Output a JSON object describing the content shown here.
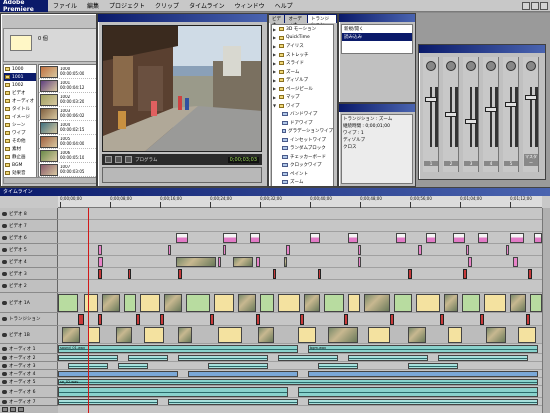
{
  "app": {
    "title": "Adobe Premiere"
  },
  "menu": [
    "ファイル",
    "編集",
    "プロジェクト",
    "クリップ",
    "タイムライン",
    "ウィンドウ",
    "ヘルプ"
  ],
  "project": {
    "label": "0 個",
    "bins": [
      {
        "label": "1000",
        "selected": false
      },
      {
        "label": "1001",
        "selected": true
      },
      {
        "label": "1002",
        "selected": false
      },
      {
        "label": "ビデオ",
        "selected": false
      },
      {
        "label": "オーディオ",
        "selected": false
      },
      {
        "label": "タイトル",
        "selected": false
      },
      {
        "label": "イメージ",
        "selected": false
      },
      {
        "label": "シーン",
        "selected": false
      },
      {
        "label": "ワイプ",
        "selected": false
      },
      {
        "label": "その他",
        "selected": false
      },
      {
        "label": "素材",
        "selected": false
      },
      {
        "label": "静止画",
        "selected": false
      },
      {
        "label": "BGM",
        "selected": false
      },
      {
        "label": "効果音",
        "selected": false
      },
      {
        "label": "完成",
        "selected": false
      }
    ],
    "clips": [
      {
        "name": "1000",
        "info": "00:00:05:00",
        "color": "#c07040"
      },
      {
        "name": "1001",
        "info": "00:00:04:12",
        "color": "#604080"
      },
      {
        "name": "1002",
        "info": "00:00:03:20",
        "color": "#a0a060"
      },
      {
        "name": "1003",
        "info": "00:00:06:02",
        "color": "#806040"
      },
      {
        "name": "1004",
        "info": "00:00:02:15",
        "color": "#407080"
      },
      {
        "name": "1005",
        "info": "00:00:04:00",
        "color": "#a06040"
      },
      {
        "name": "1006",
        "info": "00:00:05:10",
        "color": "#6a8a4a"
      },
      {
        "name": "1007",
        "info": "00:00:03:05",
        "color": "#8a5a6a"
      }
    ]
  },
  "monitor": {
    "timecode": "00:00:15:00",
    "label": "プログラム",
    "duration": "0;00;03;03"
  },
  "effects": {
    "tabs": [
      "ビデオ",
      "オーディオ",
      "トランジション"
    ],
    "folders": [
      "3D モーション",
      "QuickTime",
      "アイリス",
      "ストレッチ",
      "スライド",
      "ズーム",
      "ディゾルブ",
      "ページピール",
      "マップ",
      "ワイプ"
    ],
    "items": [
      "バンドワイプ",
      "ドアワイプ",
      "グラデーションワイプ",
      "インセットワイプ",
      "ランダムブロック",
      "チェッカーボード",
      "クロックワイプ",
      "ペイント",
      "ズーム",
      "ピンホイール",
      "ランダムワイプ"
    ]
  },
  "history": {
    "items": [
      {
        "label": "新規/開く",
        "selected": false
      },
      {
        "label": "読み込み",
        "selected": true
      }
    ]
  },
  "info": {
    "lines": [
      "トランジション : ズーム",
      "継続時間 : 0;00;01;00",
      "ワイプ : 1",
      "ディゾルブ",
      "クロス"
    ]
  },
  "mixer": {
    "strips": [
      "1",
      "2",
      "3",
      "4",
      "5",
      "マスター"
    ]
  },
  "timeline": {
    "title": "タイムライン",
    "ticks": [
      "0;00;00;00",
      "0;00;08;00",
      "0;00;16;00",
      "0;00;24;00",
      "0;00;32;00",
      "0;00;40;00",
      "0;00;48;00",
      "0;00;56;00",
      "0;01;04;00",
      "0;01;12;00"
    ],
    "tracks": [
      "ビデオ 8",
      "ビデオ 7",
      "ビデオ 6",
      "ビデオ 5",
      "ビデオ 4",
      "ビデオ 3",
      "ビデオ 2",
      "ビデオ 1A",
      "トランジション",
      "ビデオ 1B",
      "オーディオ 1",
      "オーディオ 2",
      "オーディオ 3",
      "オーディオ 4",
      "オーディオ 5",
      "オーディオ 6",
      "オーディオ 7"
    ],
    "audio_clip_names": [
      "sound_01.wav",
      "bgm.wav",
      "se_02.wav"
    ]
  },
  "colors": {
    "title_bar": "#0a1a6a",
    "pink_clip": "#e882c8",
    "yellow_clip": "#f4e2a0",
    "green_clip": "#b8dca0",
    "audio_clip": "#8ad2cc",
    "red_clip": "#c83a3a"
  }
}
